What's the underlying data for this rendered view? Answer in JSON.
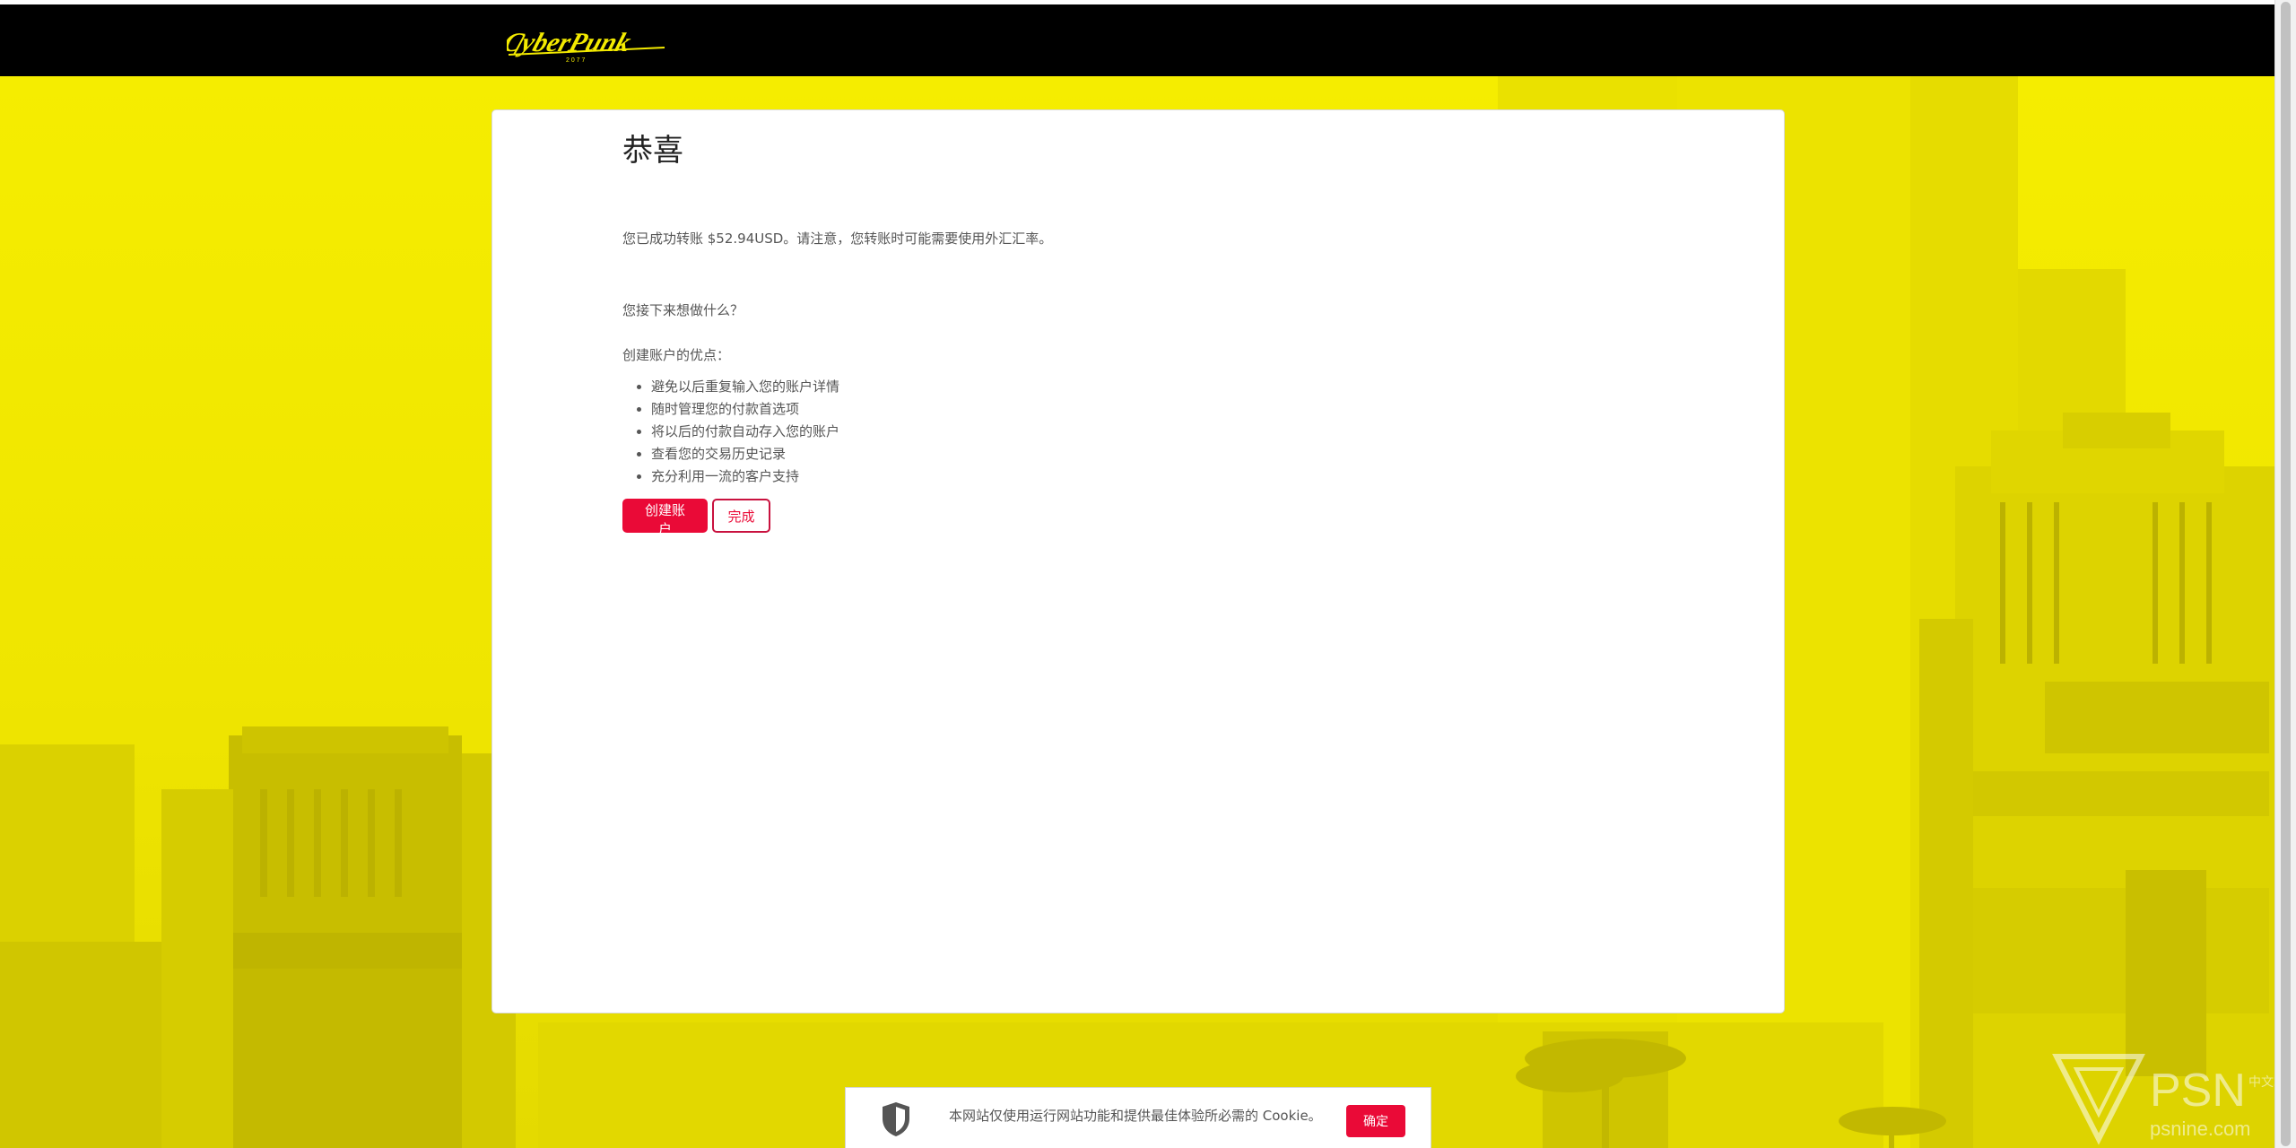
{
  "brand": {
    "logo_name": "cyberpunk-logo",
    "logo_text": "CyberPunk",
    "logo_sub": "2 0 7 7",
    "accent_color": "#ea0a37",
    "background_color": "#f3ea00"
  },
  "main": {
    "title": "恭喜",
    "transfer_message": "您已成功转账 $52.94USD。请注意，您转账时可能需要使用外汇汇率。",
    "next_question": "您接下来想做什么？",
    "benefits_heading": "创建账户的优点：",
    "benefits": [
      "避免以后重复输入您的账户详情",
      "随时管理您的付款首选项",
      "将以后的付款自动存入您的账户",
      "查看您的交易历史记录",
      "充分利用一流的客户支持"
    ],
    "create_account_label": "创建账户",
    "done_label": "完成"
  },
  "cookie_banner": {
    "icon": "shield-icon",
    "text": "本网站仅使用运行网站功能和提供最佳体验所必需的 Cookie。",
    "confirm_label": "确定"
  },
  "watermark": {
    "main": "PSN",
    "sub": "psnine.com",
    "tag": "中文站"
  }
}
